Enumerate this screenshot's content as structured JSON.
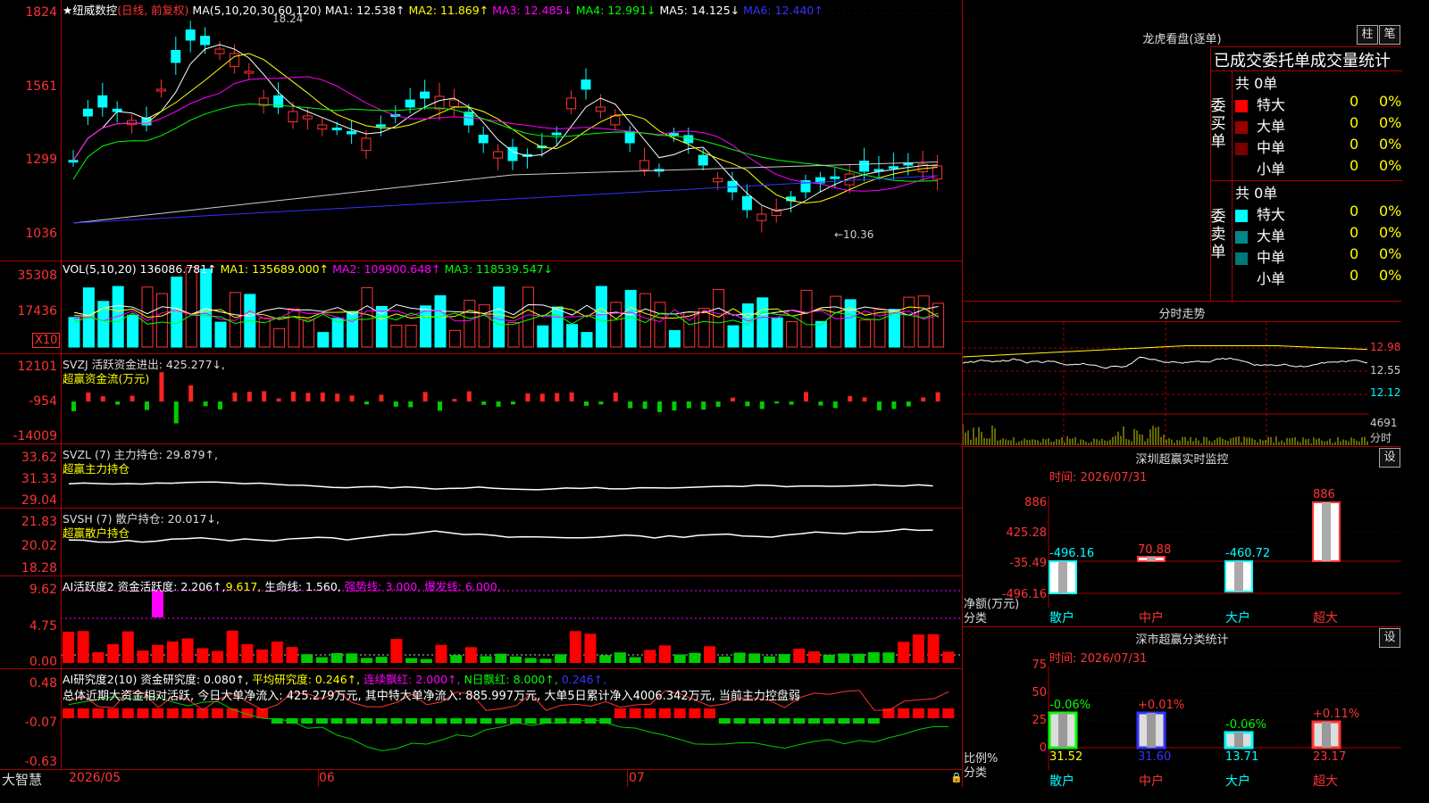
{
  "main": {
    "title_star": "★",
    "stock_name": "纽威数控",
    "kline_mode": "(日线, 前复权)",
    "ma_header": "MA(5,10,20,30,60,120)",
    "ma1": "MA1: 12.538↑",
    "ma2": "MA2: 11.869↑",
    "ma3": "MA3: 12.485↓",
    "ma4": "MA4: 12.991↓",
    "ma5": "MA5: 14.125↓",
    "ma6": "MA6: 12.440↑",
    "y_labels": [
      "1824",
      "1561",
      "1299",
      "1036"
    ],
    "high_mark": "18.24",
    "low_mark": "←10.36"
  },
  "vol": {
    "header": "VOL(5,10,20)",
    "value": "136086.781↑",
    "ma1": "MA1: 135689.000↑",
    "ma2": "MA2: 109900.648↑",
    "ma3": "MA3: 118539.547↓",
    "y_labels": [
      "35308",
      "17436"
    ],
    "unit": "X10"
  },
  "svzj": {
    "header": "SVZJ  活跃资金进出: 425.277↓,",
    "sub": "超赢资金流(万元)",
    "y_labels": [
      "12101",
      "-954",
      "-14009"
    ]
  },
  "svzl": {
    "header": "SVZL (7) 主力持仓: 29.879↑,",
    "sub": "超赢主力持仓",
    "y_labels": [
      "33.62",
      "31.33",
      "29.04"
    ]
  },
  "svsh": {
    "header": "SVSH (7) 散户持仓: 20.017↓,",
    "sub": "超赢散户持仓",
    "y_labels": [
      "21.83",
      "20.02",
      "18.28"
    ]
  },
  "ai1": {
    "header_a": "AI活跃度2 资金活跃度: 2.206↑,",
    "header_b": "9.617,",
    "header_c": "生命线: 1.560,",
    "header_d": "强势线: 3.000,",
    "header_e": "爆发线: 6.000,",
    "y_labels": [
      "9.62",
      "4.75",
      "0.00"
    ]
  },
  "ai2": {
    "header_a": "AI研究度2(10) 资金研究度: 0.080↑,",
    "header_b": "平均研究度: 0.246↑,",
    "header_c": "连续飘红: 2.000↑,",
    "header_d": "N日飘红: 8.000↑,",
    "header_e": "0.246↑,",
    "summary": "总体近期大资金相对活跃, 今日大单净流入: 425.279万元, 其中特大单净流入: 885.997万元, 大单5日累计净入4006.342万元, 当前主力控盘弱",
    "y_labels": [
      "0.48",
      "-0.07",
      "-0.63"
    ]
  },
  "xaxis": {
    "brand": "大智慧",
    "labels": [
      "2026/05",
      "06",
      "07"
    ]
  },
  "lhb": {
    "title": "龙虎看盘(逐单)",
    "btn1": "柱",
    "btn2": "笔",
    "header": "已成交委托单成交量统计",
    "buy_label": "委买单",
    "buy_total": "共 0单",
    "sell_label": "委卖单",
    "sell_total": "共 0单",
    "rows": [
      "特大",
      "大单",
      "中单",
      "小单"
    ],
    "zero": "0",
    "pct": "0%"
  },
  "fenshi": {
    "title": "分时走势",
    "y_labels": [
      "12.98",
      "12.55",
      "12.12"
    ],
    "vol_label": "4691",
    "sub": "分时"
  },
  "sz_monitor": {
    "title": "深圳超赢实时监控",
    "btn": "设",
    "time": "时间: 2026/07/31",
    "y_labels": [
      "886",
      "425.28",
      "-35.49",
      "-496.16"
    ],
    "axis_title": "净额(万元)",
    "axis_sub": "分类",
    "categories": [
      "散户",
      "中户",
      "大户",
      "超大"
    ],
    "values": [
      "-496.16",
      "70.88",
      "-460.72",
      "886"
    ]
  },
  "sz_stats": {
    "title": "深市超赢分类统计",
    "btn": "设",
    "time": "时间: 2026/07/31",
    "y_labels": [
      "75",
      "50",
      "25",
      "0"
    ],
    "axis_title": "比例%",
    "axis_sub": "分类",
    "categories": [
      "散户",
      "中户",
      "大户",
      "超大"
    ],
    "changes": [
      "-0.06%",
      "+0.01%",
      "-0.06%",
      "+0.11%"
    ],
    "values": [
      "31.52",
      "31.60",
      "13.71",
      "23.17"
    ]
  }
}
